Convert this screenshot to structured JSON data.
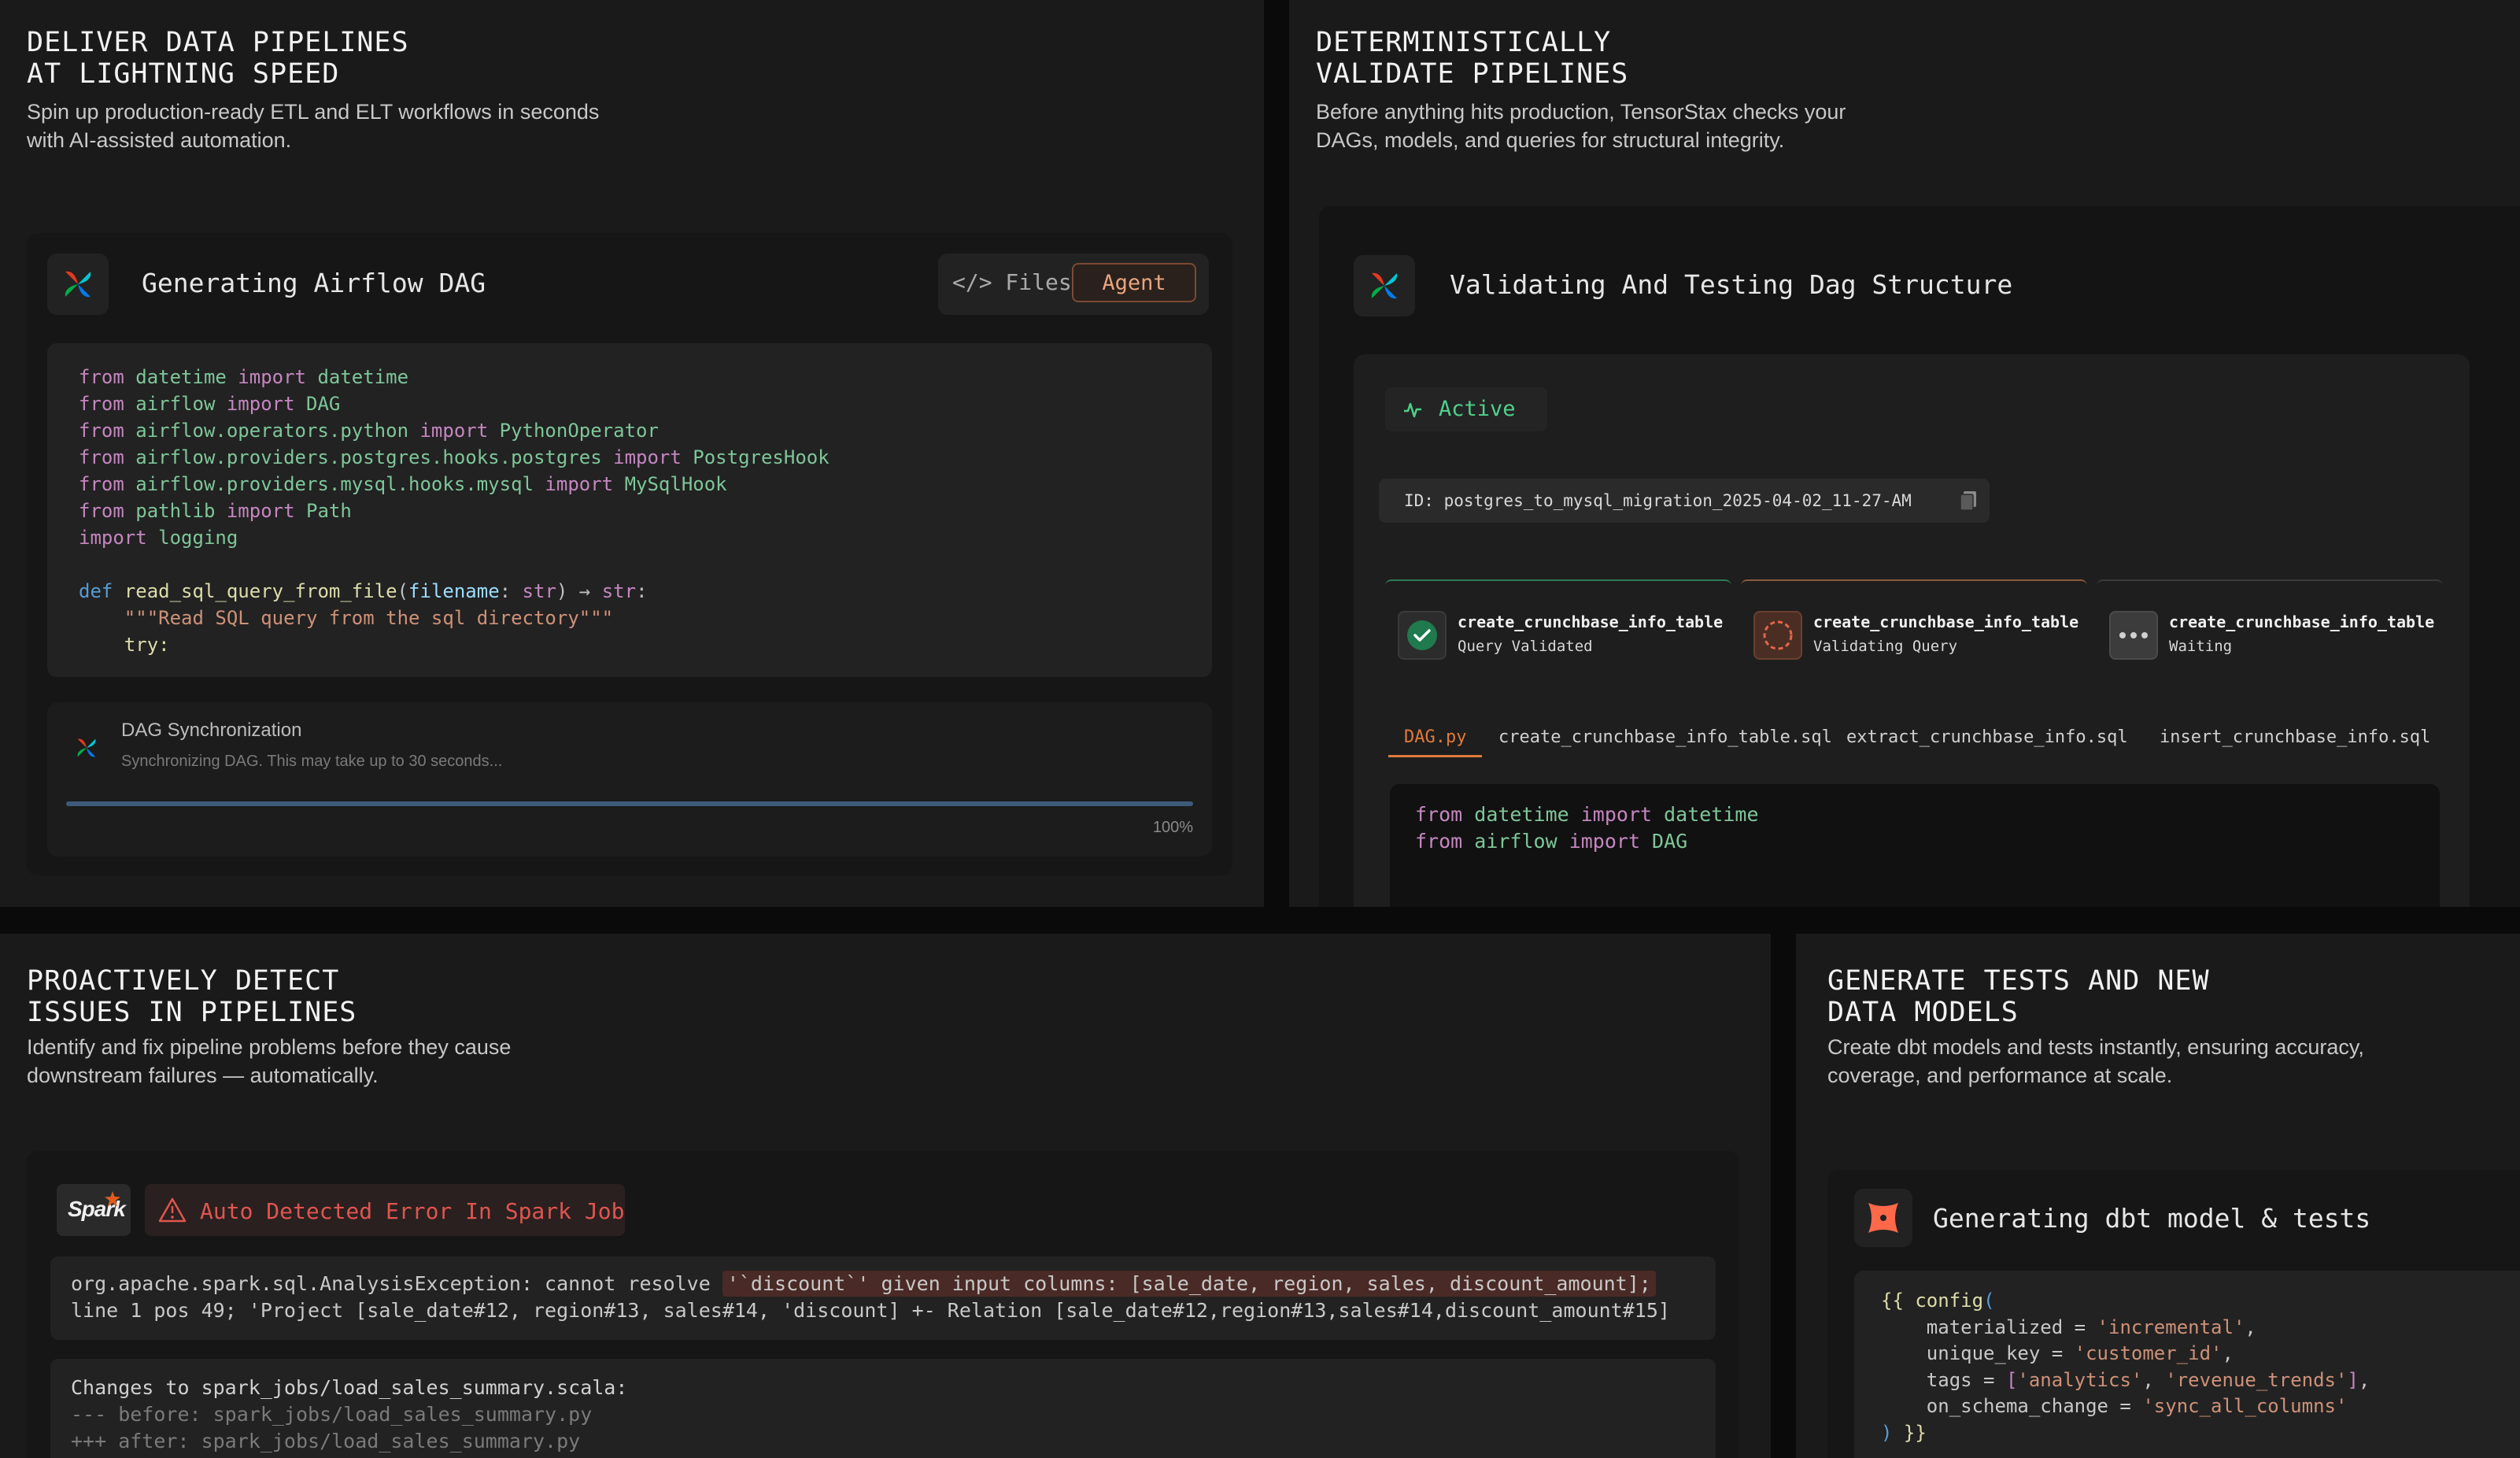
{
  "panels": {
    "pipelines": {
      "title_line1": "DELIVER DATA PIPELINES",
      "title_line2": "AT LIGHTNING SPEED",
      "desc_line1": "Spin up production-ready ETL and ELT workflows in seconds",
      "desc_line2": "with AI-assisted automation.",
      "card_title": "Generating Airflow DAG",
      "files_label": "</> Files",
      "agent_label": "Agent",
      "code": {
        "l1": [
          "from",
          " datetime ",
          "import",
          " datetime"
        ],
        "l2": [
          "from",
          " airflow ",
          "import",
          " DAG"
        ],
        "l3": [
          "from",
          " airflow.operators.python ",
          "import",
          " PythonOperator"
        ],
        "l4": [
          "from",
          " airflow.providers.postgres.hooks.postgres ",
          "import",
          " PostgresHook"
        ],
        "l5": [
          "from",
          " airflow.providers.mysql.hooks.mysql ",
          "import",
          " MySqlHook"
        ],
        "l6": [
          "from",
          " pathlib ",
          "import",
          " Path"
        ],
        "l7": [
          "import",
          " logging"
        ],
        "l9": [
          "def",
          " ",
          "read_sql_query_from_file",
          "(",
          "filename",
          ": ",
          "str",
          ") → ",
          "str",
          ":"
        ],
        "l10": "    \"\"\"Read SQL query from the sql directory\"\"\"",
        "l11": "    try:"
      },
      "sync_title": "DAG Synchronization",
      "sync_text": "Synchronizing DAG. This may take up to 30 seconds...",
      "sync_percent": "100%",
      "sync_progress": 1.0
    },
    "validate": {
      "title_line1": "DETERMINISTICALLY",
      "title_line2": "VALIDATE PIPELINES",
      "desc_line1": "Before anything hits production, TensorStax checks your",
      "desc_line2": "DAGs, models, and queries for structural integrity.",
      "card_title": "Validating And Testing Dag Structure",
      "status": "Active",
      "run_id": "ID: postgres_to_mysql_migration_2025-04-02_11-27-AM",
      "steps": [
        {
          "name": "create_crunchbase_info_table",
          "status": "Query Validated",
          "state_color": "#1f7a4d"
        },
        {
          "name": "create_crunchbase_info_table",
          "status": "Validating Query",
          "state_color": "#e2674a"
        },
        {
          "name": "create_crunchbase_info_table",
          "status": "Waiting",
          "state_color": "#4a4a4a"
        }
      ],
      "file_tabs": [
        "DAG.py",
        "create_crunchbase_info_table.sql",
        "extract_crunchbase_info.sql",
        "insert_crunchbase_info.sql"
      ],
      "code": {
        "l1": [
          "from",
          " datetime ",
          "import",
          " datetime"
        ],
        "l2": [
          "from",
          " airflow ",
          "import",
          " DAG"
        ]
      }
    },
    "detect": {
      "title_line1": "PROACTIVELY DETECT",
      "title_line2": "ISSUES IN PIPELINES",
      "desc_line1": "Identify and fix pipeline problems before they cause",
      "desc_line2": "downstream failures — automatically.",
      "spark_logo": "Spark",
      "error_badge": "Auto Detected Error In Spark Job",
      "error_l1_a": "org.apache.spark.sql.AnalysisException: cannot resolve ",
      "error_l1_b": "'`discount`' given input columns: [sale_date, region, sales, discount_amount];",
      "error_l2": "line 1 pos 49; 'Project [sale_date#12, region#13, sales#14, 'discount] +- Relation [sale_date#12,region#13,sales#14,discount_amount#15]",
      "changes_l1": "Changes to spark_jobs/load_sales_summary.scala:",
      "changes_l2": "--- before: spark_jobs/load_sales_summary.py",
      "changes_l3": "+++ after: spark_jobs/load_sales_summary.py"
    },
    "dbt": {
      "title_line1": "GENERATE TESTS AND NEW",
      "title_line2": "DATA MODELS",
      "desc_line1": "Create dbt models and tests instantly, ensuring accuracy,",
      "desc_line2": "coverage, and performance at scale.",
      "card_title": "Generating dbt model & tests",
      "code": {
        "l1_a": "{{ ",
        "l1_b": "config",
        "l1_c": "(",
        "l2_k": "    materialized = ",
        "l2_v": "'incremental'",
        "l2_e": ",",
        "l3_k": "    unique_key = ",
        "l3_v": "'customer_id'",
        "l3_e": ",",
        "l4_k": "    tags = ",
        "l4_b1": "[",
        "l4_v1": "'analytics'",
        "l4_c": ", ",
        "l4_v2": "'revenue_trends'",
        "l4_b2": "]",
        "l4_e": ",",
        "l5_k": "    on_schema_change = ",
        "l5_v": "'sync_all_columns'",
        "l6_a": ") ",
        "l6_b": "}}"
      }
    }
  },
  "colors": {
    "accent_orange": "#e07a3a",
    "active_green": "#4fd18b",
    "error_red": "#e0554f"
  }
}
